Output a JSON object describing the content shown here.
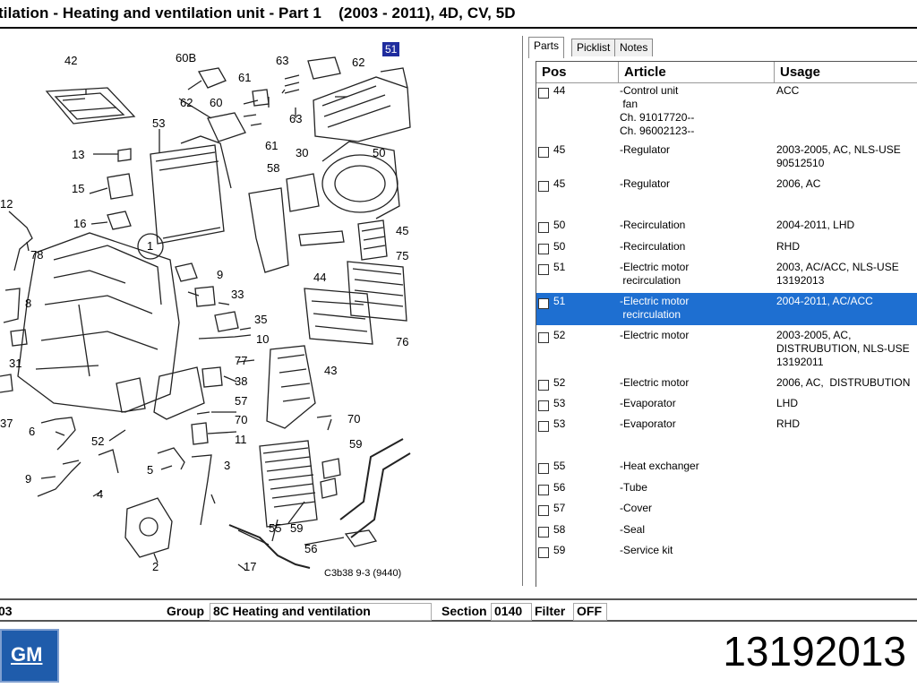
{
  "title": "tilation - Heating and ventilation unit - Part 1    (2003 - 2011), 4D, CV, 5D",
  "diagram": {
    "highlight_label": "51",
    "figure_code": "C3b38 9-3 (9440)",
    "callouts": [
      "42",
      "60B",
      "63",
      "62",
      "61",
      "62",
      "60",
      "63",
      "53",
      "13",
      "61",
      "30",
      "50",
      "15",
      "58",
      "16",
      "12",
      "1",
      "45",
      "78",
      "75",
      "9",
      "44",
      "8",
      "33",
      "35",
      "10",
      "31",
      "43",
      "77",
      "38",
      "57",
      "70",
      "76",
      "37",
      "6",
      "52",
      "70",
      "11",
      "59",
      "9",
      "5",
      "3",
      "4",
      "55",
      "59",
      "56",
      "2",
      "17"
    ]
  },
  "tabs": [
    {
      "label": "Parts",
      "active": true
    },
    {
      "label": "Picklist",
      "active": false
    },
    {
      "label": "Notes",
      "active": false
    }
  ],
  "columns": {
    "pos": "Pos",
    "article": "Article",
    "usage": "Usage"
  },
  "rows": [
    {
      "pos": "44",
      "article": "-Control unit\n fan\nCh. 91017720--\nCh. 96002123--",
      "usage": "ACC"
    },
    {
      "pos": "45",
      "article": "-Regulator",
      "usage": "2003-2005, AC, NLS-USE\n90512510"
    },
    {
      "pos": "45",
      "article": "-Regulator",
      "usage": "2006, AC"
    },
    {
      "pos": "50",
      "article": "-Recirculation",
      "usage": "2004-2011, LHD"
    },
    {
      "pos": "50",
      "article": "-Recirculation",
      "usage": "RHD"
    },
    {
      "pos": "51",
      "article": "-Electric motor\n recirculation",
      "usage": "2003, AC/ACC, NLS-USE\n13192013"
    },
    {
      "pos": "51",
      "article": "-Electric motor\n recirculation",
      "usage": "2004-2011, AC/ACC",
      "selected": true
    },
    {
      "pos": "52",
      "article": "-Electric motor",
      "usage": "2003-2005, AC,\nDISTRUBUTION, NLS-USE\n13192011"
    },
    {
      "pos": "52",
      "article": "-Electric motor",
      "usage": "2006, AC,  DISTRUBUTION"
    },
    {
      "pos": "53",
      "article": "-Evaporator",
      "usage": "LHD"
    },
    {
      "pos": "53",
      "article": "-Evaporator",
      "usage": "RHD"
    },
    {
      "pos": "55",
      "article": "-Heat exchanger",
      "usage": ""
    },
    {
      "pos": "56",
      "article": "-Tube",
      "usage": ""
    },
    {
      "pos": "57",
      "article": "-Cover",
      "usage": ""
    },
    {
      "pos": "58",
      "article": "-Seal",
      "usage": ""
    },
    {
      "pos": "59",
      "article": "-Service kit",
      "usage": ""
    }
  ],
  "status": {
    "left_value": "03",
    "group_label": "Group",
    "group_value": "8C Heating and ventilation",
    "section_label": "Section",
    "section_value": "0140",
    "filter_label": "Filter",
    "filter_value": "OFF"
  },
  "logo_text": "GM",
  "part_number": "13192013",
  "colors": {
    "selection": "#1e6fd1",
    "highlight_tag": "#1f2c9e",
    "gm_blue": "#1f5cab"
  }
}
